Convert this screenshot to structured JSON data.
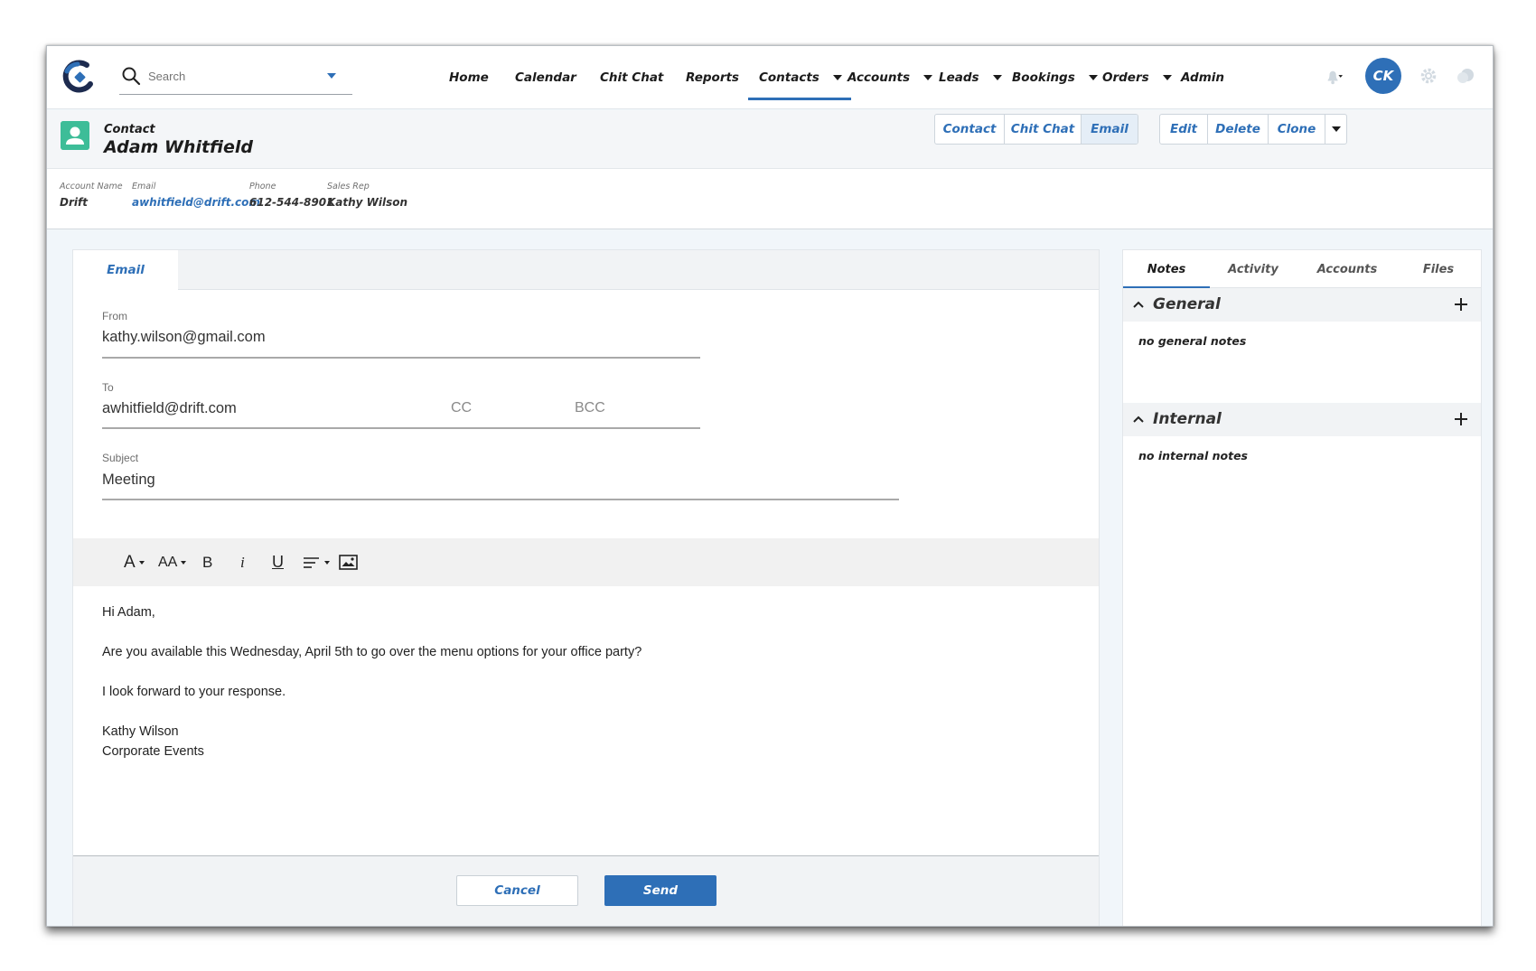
{
  "colors": {
    "accent": "#2e6fb7",
    "contact_icon": "#3dbd98",
    "avatar_bg": "#2e6fb7"
  },
  "search": {
    "placeholder": "Search"
  },
  "nav": {
    "home": "Home",
    "calendar": "Calendar",
    "chitchat": "Chit Chat",
    "reports": "Reports",
    "contacts": "Contacts",
    "accounts": "Accounts",
    "leads": "Leads",
    "bookings": "Bookings",
    "orders": "Orders",
    "admin": "Admin",
    "active": "Contacts"
  },
  "user": {
    "initials": "CK"
  },
  "record": {
    "type": "Contact",
    "name": "Adam Whitfield",
    "view_tabs": [
      "Contact",
      "Chit Chat",
      "Email"
    ],
    "active_view": "Email",
    "actions": [
      "Edit",
      "Delete",
      "Clone"
    ]
  },
  "highlights": {
    "account_label": "Account Name",
    "account": "Drift",
    "email_label": "Email",
    "email": "awhitfield@drift.com",
    "phone_label": "Phone",
    "phone": "612-544-8901",
    "rep_label": "Sales Rep",
    "rep": "Kathy Wilson"
  },
  "composer": {
    "tab": "Email",
    "from_label": "From",
    "from": "kathy.wilson@gmail.com",
    "to_label": "To",
    "to": "awhitfield@drift.com",
    "cc": "CC",
    "bcc": "BCC",
    "subject_label": "Subject",
    "subject": "Meeting",
    "toolbar": {
      "font": "A",
      "size": "AA",
      "bold": "B",
      "italic": "i",
      "underline": "U"
    },
    "body": {
      "greeting": "Hi Adam,",
      "line1": "Are you available this Wednesday, April 5th to go over the menu options for your office party?",
      "line2": "I look forward to your response.",
      "sig_name": "Kathy Wilson",
      "sig_title": "Corporate Events"
    },
    "cancel": "Cancel",
    "send": "Send"
  },
  "side": {
    "tabs": [
      "Notes",
      "Activity",
      "Accounts",
      "Files"
    ],
    "active_tab": "Notes",
    "general_title": "General",
    "general_empty": "no general notes",
    "internal_title": "Internal",
    "internal_empty": "no internal notes"
  }
}
